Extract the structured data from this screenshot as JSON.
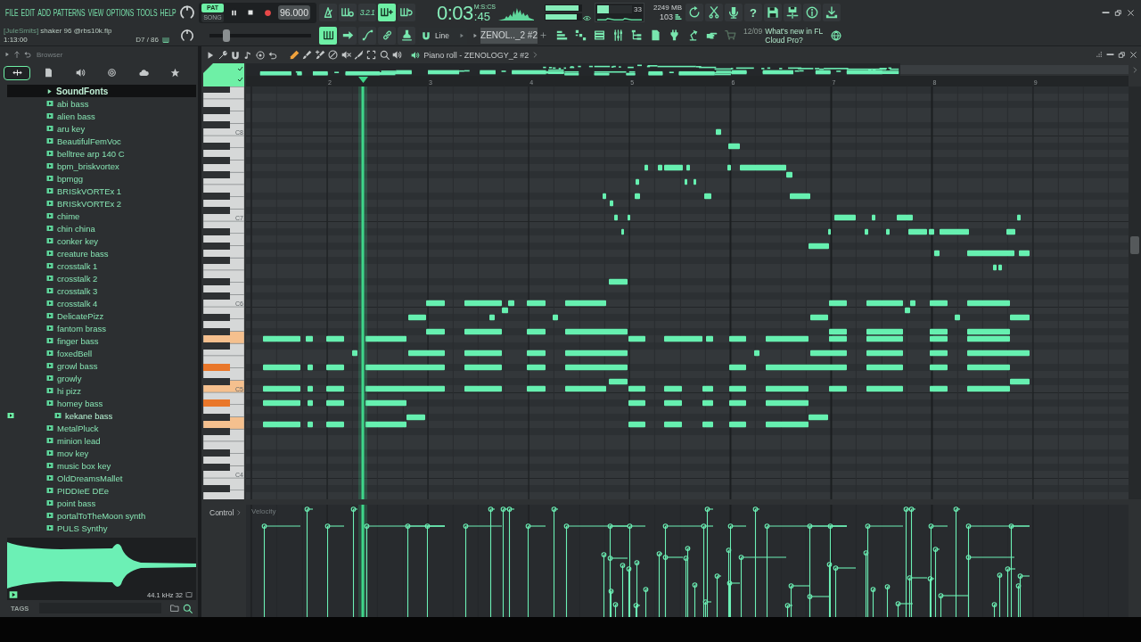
{
  "menu": [
    "FILE",
    "EDIT",
    "ADD",
    "PATTERNS",
    "VIEW",
    "OPTIONS",
    "TOOLS",
    "HELP"
  ],
  "transport": {
    "modes": [
      {
        "label": "PAT",
        "selected": true
      },
      {
        "label": "SONG",
        "selected": false
      }
    ],
    "tempo": "96.000"
  },
  "record_toggles": [
    {
      "kind": "icon",
      "on": false
    },
    {
      "kind": "icon",
      "on": false
    },
    {
      "kind": "text",
      "label": "3.2.1",
      "on": false
    },
    {
      "kind": "icon",
      "on": true
    },
    {
      "kind": "icon",
      "on": false
    }
  ],
  "time": {
    "value": "0:03",
    "fraction": ":45",
    "format": "M:S:CS"
  },
  "master": [
    {
      "level": 0.93
    },
    {
      "level": 0.88
    }
  ],
  "cpu": {
    "level": 0.33,
    "reading": "33",
    "memory": "2249 MB",
    "voices": "103"
  },
  "toolbar": {
    "help": "?"
  },
  "hint": {
    "user": "[JuleSmits]",
    "text": "shaker 96 @rbs10k.flp",
    "position": "1:13:00",
    "note": "D7 / 86"
  },
  "slider": {
    "level": 0.17
  },
  "tools": [
    {
      "on": true
    },
    {
      "on": false
    },
    {
      "on": false
    },
    {
      "on": false
    },
    {
      "on": false
    }
  ],
  "snap": {
    "label": "Line"
  },
  "pattern": {
    "label": "ZENOL.._2 #2"
  },
  "news": {
    "date": "12/09",
    "text": "What's new in FL Cloud Pro?"
  },
  "browser": {
    "title": "Browser",
    "tabs": [
      {
        "selected": true
      },
      {
        "selected": false
      },
      {
        "selected": false
      },
      {
        "selected": false
      },
      {
        "selected": false
      },
      {
        "selected": false
      }
    ],
    "items": [
      {
        "label": "SoundFonts",
        "kind": "folder",
        "selected": false
      },
      {
        "label": "abi bass",
        "kind": "preset",
        "selected": false
      },
      {
        "label": "alien bass",
        "kind": "preset",
        "selected": false
      },
      {
        "label": "aru key",
        "kind": "preset",
        "selected": false
      },
      {
        "label": "BeautifulFemVoc",
        "kind": "preset",
        "selected": false
      },
      {
        "label": "belltree arp 140 C",
        "kind": "preset",
        "selected": false
      },
      {
        "label": "bpm_briskvortex",
        "kind": "preset",
        "selected": false
      },
      {
        "label": "bpmgg",
        "kind": "preset",
        "selected": false
      },
      {
        "label": "BRISkVORTEx 1",
        "kind": "preset",
        "selected": false
      },
      {
        "label": "BRISkVORTEx 2",
        "kind": "preset",
        "selected": false
      },
      {
        "label": "chime",
        "kind": "preset",
        "selected": false
      },
      {
        "label": "chin china",
        "kind": "preset",
        "selected": false
      },
      {
        "label": "conker key",
        "kind": "preset",
        "selected": false
      },
      {
        "label": "creature bass",
        "kind": "preset",
        "selected": false
      },
      {
        "label": "crosstalk 1",
        "kind": "preset",
        "selected": false
      },
      {
        "label": "crosstalk 2",
        "kind": "preset",
        "selected": false
      },
      {
        "label": "crosstalk 3",
        "kind": "preset",
        "selected": false
      },
      {
        "label": "crosstalk 4",
        "kind": "preset",
        "selected": false
      },
      {
        "label": "DelicatePizz",
        "kind": "preset",
        "selected": false
      },
      {
        "label": "fantom brass",
        "kind": "preset",
        "selected": false
      },
      {
        "label": "finger bass",
        "kind": "preset",
        "selected": false
      },
      {
        "label": "foxedBell",
        "kind": "preset",
        "selected": false
      },
      {
        "label": "growl bass",
        "kind": "preset",
        "selected": false
      },
      {
        "label": "growly",
        "kind": "preset",
        "selected": false
      },
      {
        "label": "hi pizz",
        "kind": "preset",
        "selected": false
      },
      {
        "label": "homey bass",
        "kind": "preset",
        "selected": false,
        "children": [
          {
            "label": "kekane bass",
            "kind": "preset",
            "selected": true
          }
        ]
      },
      {
        "label": "MetalPluck",
        "kind": "preset",
        "selected": false
      },
      {
        "label": "minion lead",
        "kind": "preset",
        "selected": false
      },
      {
        "label": "mov key",
        "kind": "preset",
        "selected": false
      },
      {
        "label": "music box key",
        "kind": "preset",
        "selected": false
      },
      {
        "label": "OldDreamsMallet",
        "kind": "preset",
        "selected": false
      },
      {
        "label": "PIDDIeE DEe",
        "kind": "preset",
        "selected": false
      },
      {
        "label": "point bass",
        "kind": "preset",
        "selected": false
      },
      {
        "label": "portalToTheMoon synth",
        "kind": "preset",
        "selected": false
      },
      {
        "label": "PULS Synthy",
        "kind": "preset",
        "selected": false
      }
    ]
  },
  "preview": {
    "info": "44.1 kHz 32"
  },
  "tags": {
    "label": "TAGS"
  },
  "piano_roll": {
    "title": "Piano roll - ZENOLOGY_2 #2",
    "bars": [
      "2",
      "3",
      "4",
      "5",
      "6",
      "7",
      "8",
      "9"
    ],
    "keys": [
      "C8",
      "C7",
      "C6",
      "C5",
      "C4"
    ],
    "control": {
      "label": "Control",
      "parameter": "Velocity"
    }
  }
}
